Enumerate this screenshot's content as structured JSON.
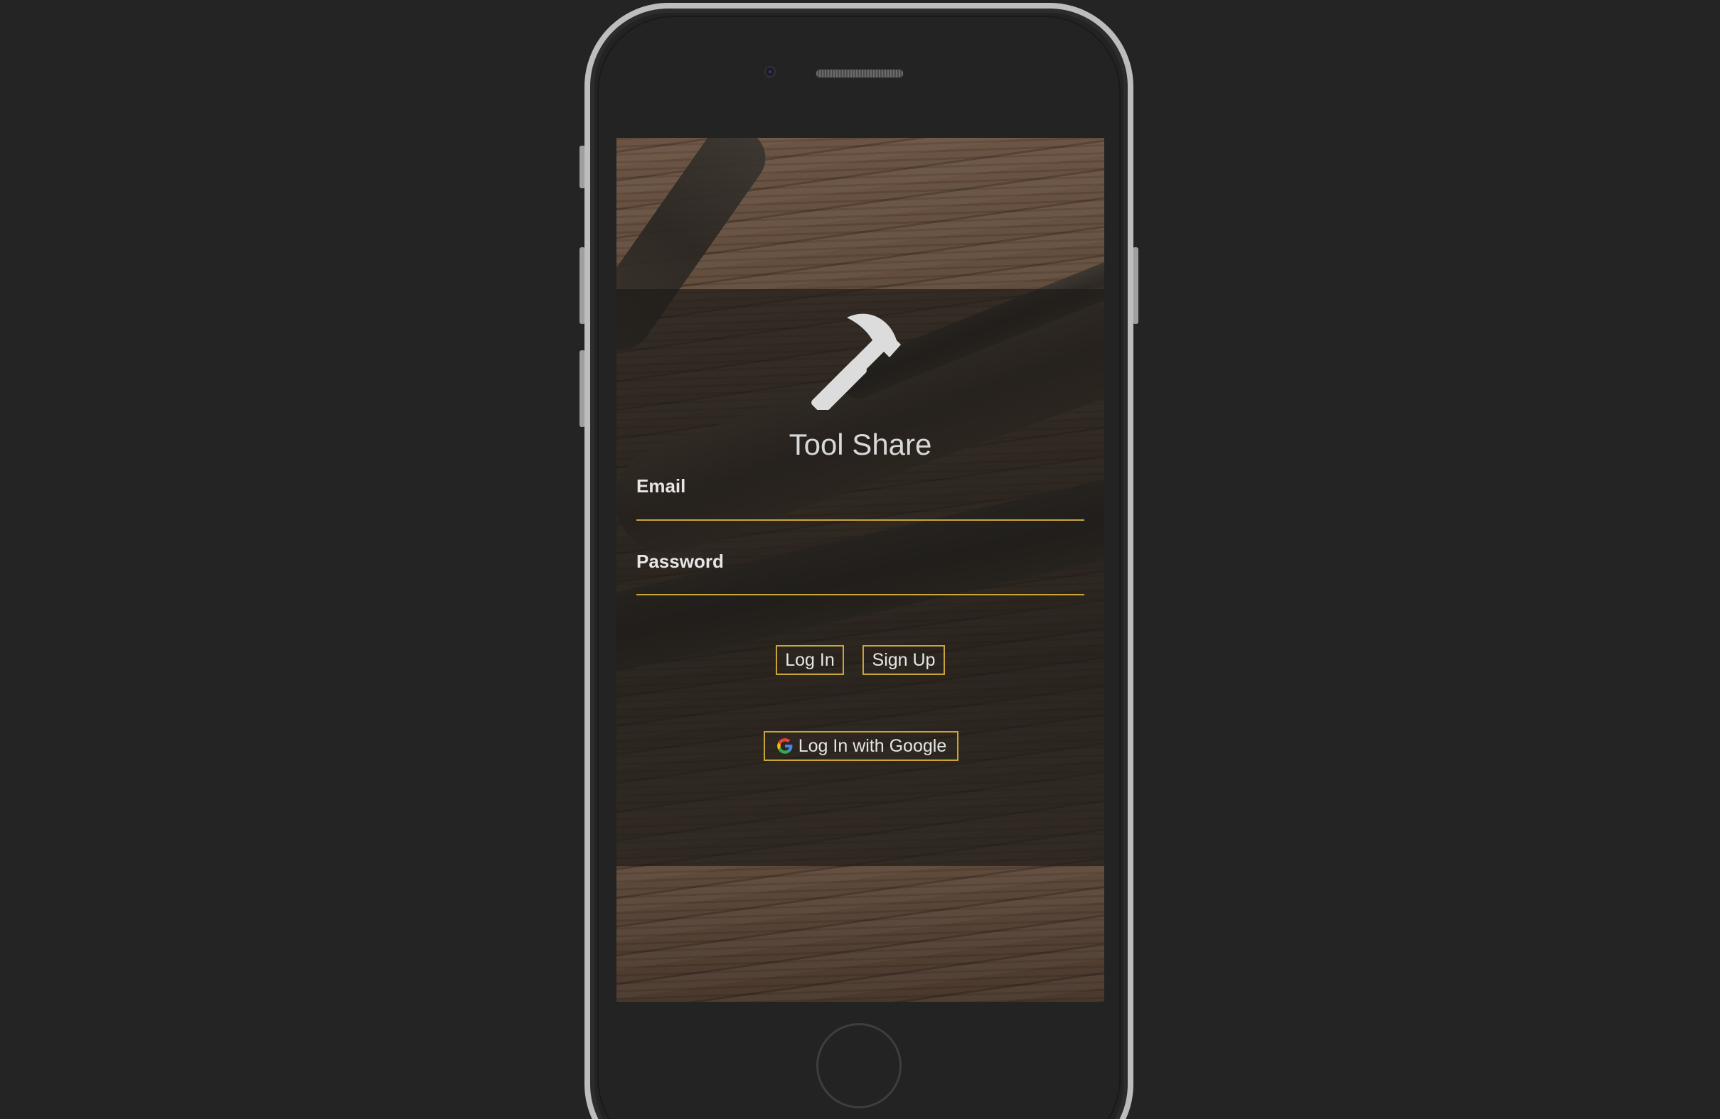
{
  "app": {
    "title": "Tool Share",
    "logo_icon": "hammer-icon"
  },
  "form": {
    "email_label": "Email",
    "email_value": "",
    "password_label": "Password",
    "password_value": ""
  },
  "buttons": {
    "login_label": "Log In",
    "signup_label": "Sign Up",
    "google_label": "Log In with Google",
    "google_icon": "google-g-icon"
  },
  "colors": {
    "accent": "#c9a43a",
    "panel_overlay": "rgba(28,26,24,0.68)",
    "background": "#242424"
  }
}
